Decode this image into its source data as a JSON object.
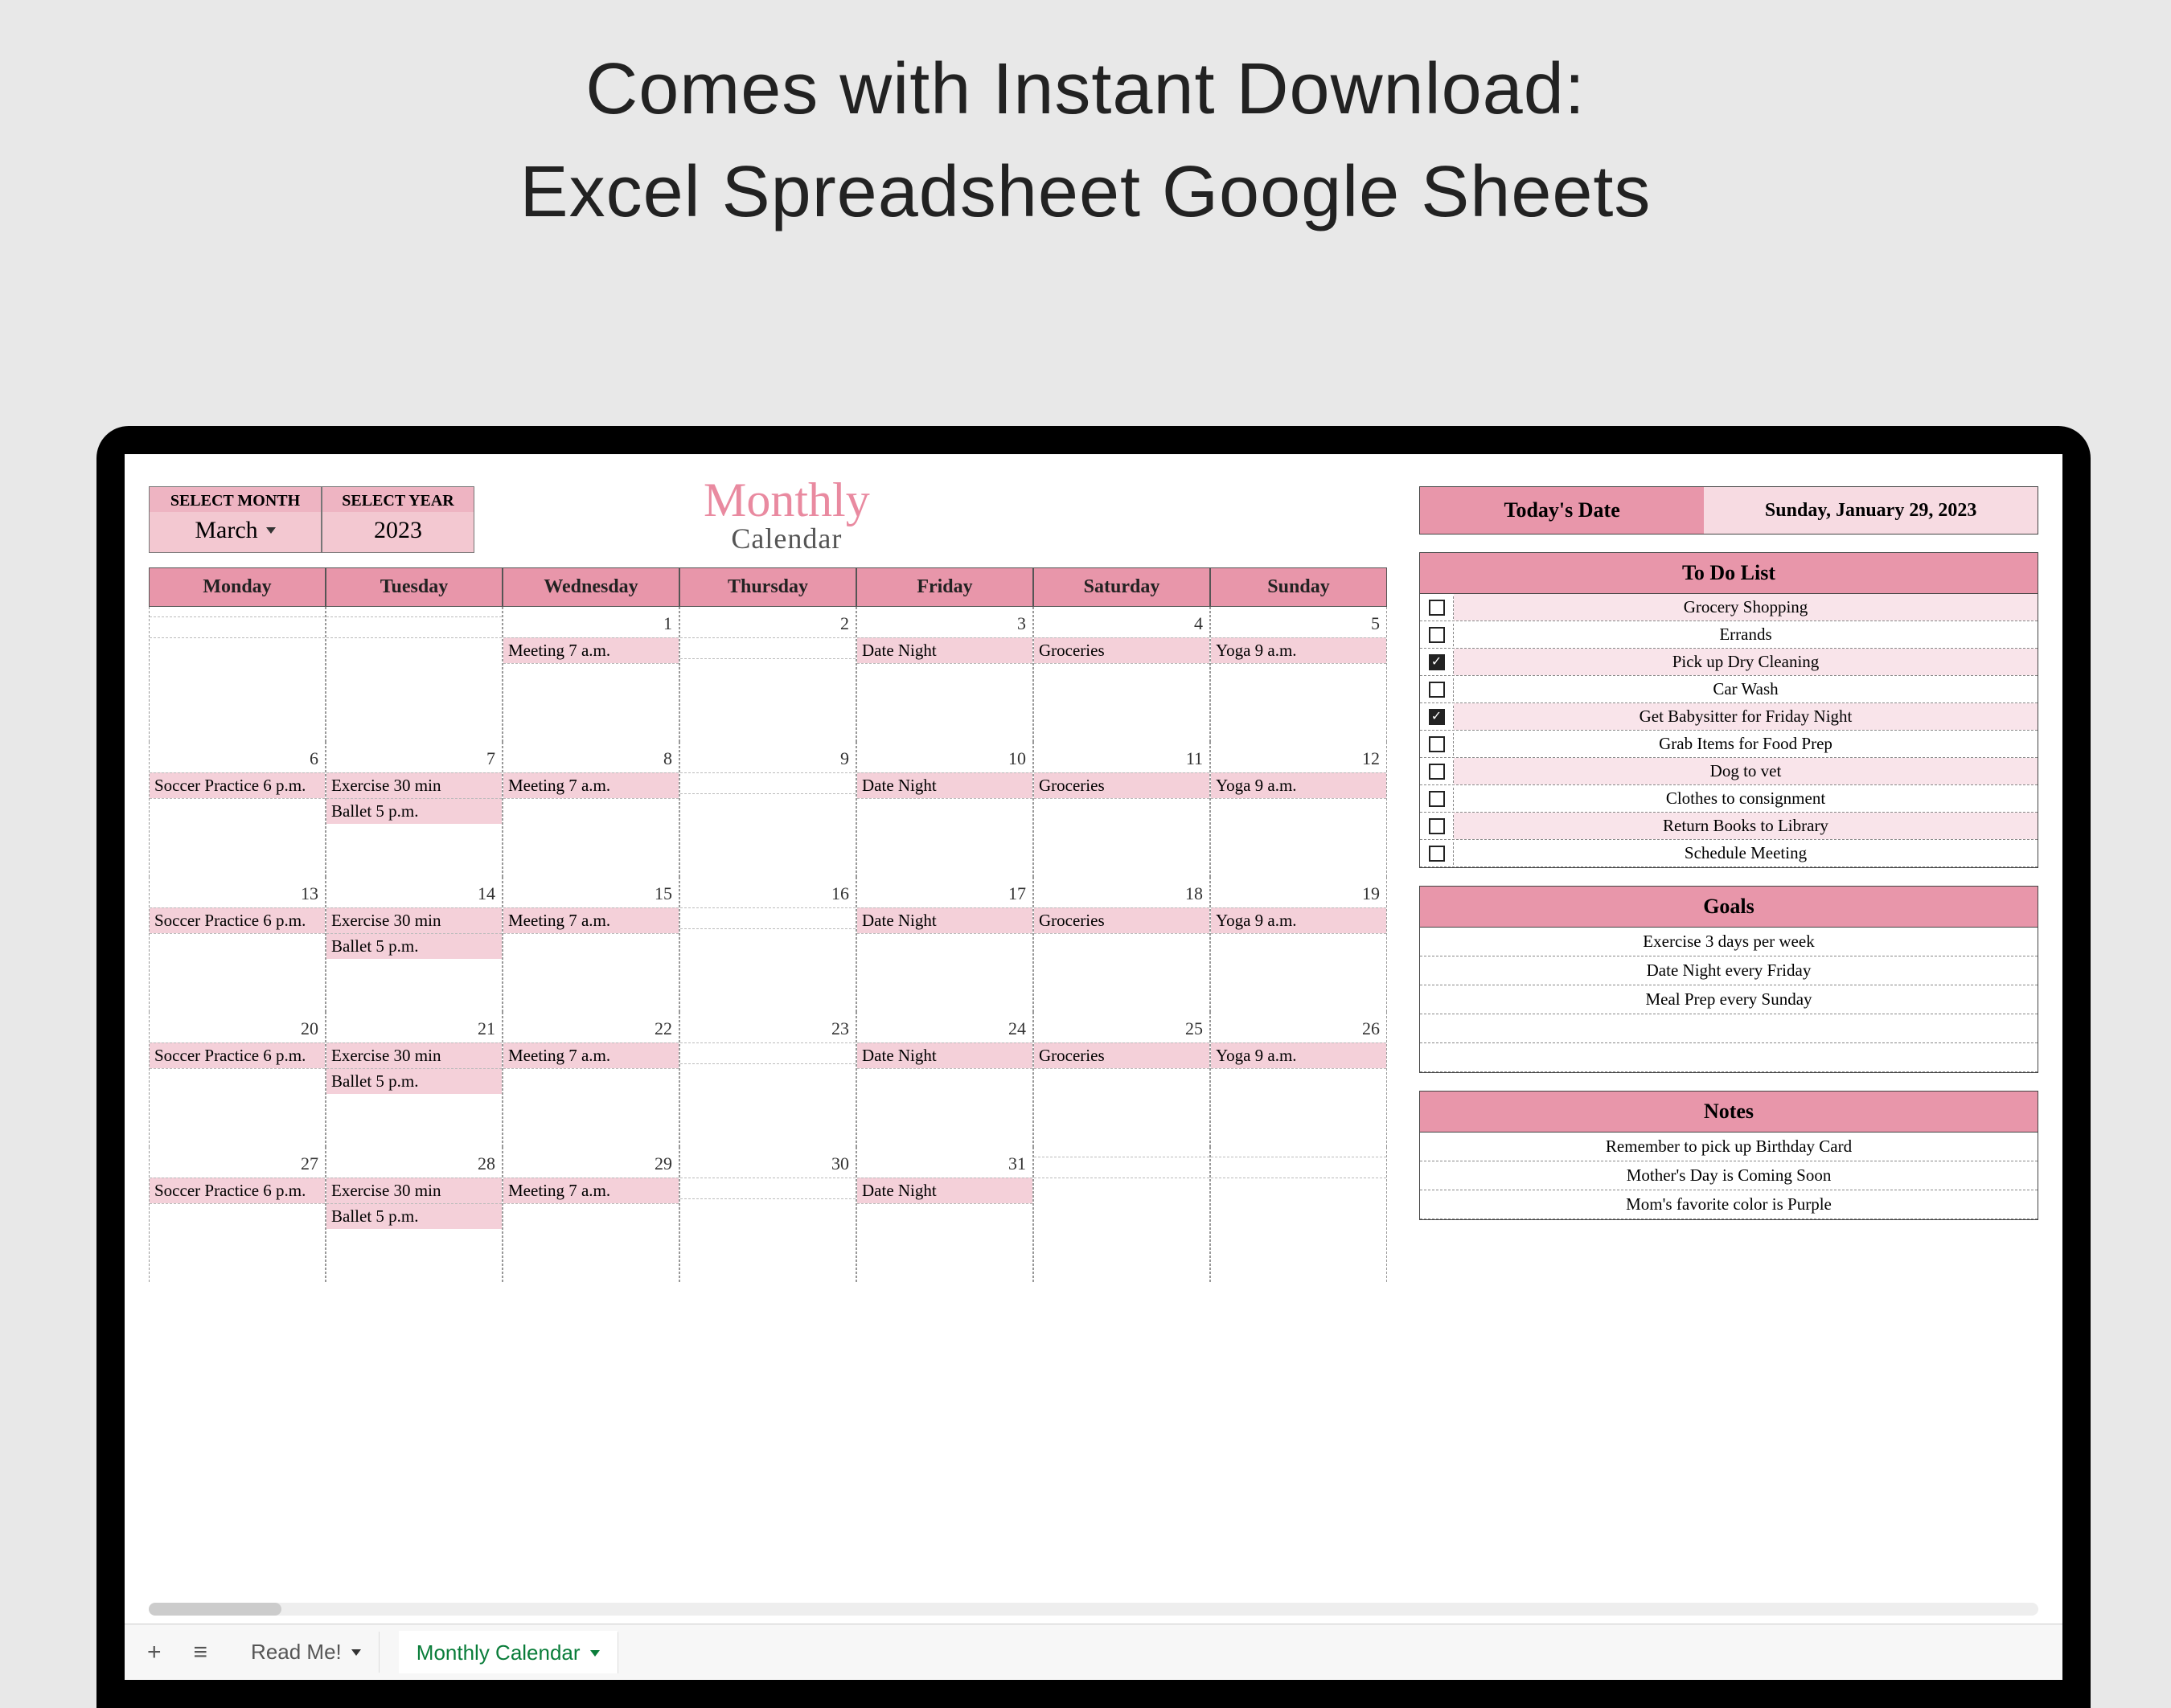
{
  "promo": {
    "line1": "Comes with Instant Download:",
    "line2": "Excel Spreadsheet Google Sheets"
  },
  "selectors": {
    "month_label": "SELECT MONTH",
    "month_value": "March",
    "year_label": "SELECT YEAR",
    "year_value": "2023"
  },
  "logo": {
    "script": "Monthly",
    "sub": "Calendar"
  },
  "day_headers": [
    "Monday",
    "Tuesday",
    "Wednesday",
    "Thursday",
    "Friday",
    "Saturday",
    "Sunday"
  ],
  "weeks": [
    [
      {
        "date": "",
        "events": []
      },
      {
        "date": "",
        "events": []
      },
      {
        "date": "1",
        "events": [
          "Meeting 7 a.m."
        ]
      },
      {
        "date": "2",
        "events": []
      },
      {
        "date": "3",
        "events": [
          "Date Night"
        ]
      },
      {
        "date": "4",
        "events": [
          "Groceries"
        ]
      },
      {
        "date": "5",
        "events": [
          "Yoga 9 a.m."
        ]
      }
    ],
    [
      {
        "date": "6",
        "events": [
          "Soccer Practice 6 p.m."
        ]
      },
      {
        "date": "7",
        "events": [
          "Exercise 30 min",
          "Ballet 5 p.m."
        ]
      },
      {
        "date": "8",
        "events": [
          "Meeting 7 a.m."
        ]
      },
      {
        "date": "9",
        "events": []
      },
      {
        "date": "10",
        "events": [
          "Date Night"
        ]
      },
      {
        "date": "11",
        "events": [
          "Groceries"
        ]
      },
      {
        "date": "12",
        "events": [
          "Yoga 9 a.m."
        ]
      }
    ],
    [
      {
        "date": "13",
        "events": [
          "Soccer Practice 6 p.m."
        ]
      },
      {
        "date": "14",
        "events": [
          "Exercise 30 min",
          "Ballet 5 p.m."
        ]
      },
      {
        "date": "15",
        "events": [
          "Meeting 7 a.m."
        ]
      },
      {
        "date": "16",
        "events": []
      },
      {
        "date": "17",
        "events": [
          "Date Night"
        ]
      },
      {
        "date": "18",
        "events": [
          "Groceries"
        ]
      },
      {
        "date": "19",
        "events": [
          "Yoga 9 a.m."
        ]
      }
    ],
    [
      {
        "date": "20",
        "events": [
          "Soccer Practice 6 p.m."
        ]
      },
      {
        "date": "21",
        "events": [
          "Exercise 30 min",
          "Ballet 5 p.m."
        ]
      },
      {
        "date": "22",
        "events": [
          "Meeting 7 a.m."
        ]
      },
      {
        "date": "23",
        "events": []
      },
      {
        "date": "24",
        "events": [
          "Date Night"
        ]
      },
      {
        "date": "25",
        "events": [
          "Groceries"
        ]
      },
      {
        "date": "26",
        "events": [
          "Yoga 9 a.m."
        ]
      }
    ],
    [
      {
        "date": "27",
        "events": [
          "Soccer Practice 6 p.m."
        ]
      },
      {
        "date": "28",
        "events": [
          "Exercise 30 min",
          "Ballet 5 p.m."
        ]
      },
      {
        "date": "29",
        "events": [
          "Meeting 7 a.m."
        ]
      },
      {
        "date": "30",
        "events": []
      },
      {
        "date": "31",
        "events": [
          "Date Night"
        ]
      },
      {
        "date": "",
        "events": []
      },
      {
        "date": "",
        "events": []
      }
    ]
  ],
  "today": {
    "label": "Today's  Date",
    "value": "Sunday, January 29, 2023"
  },
  "todo": {
    "title": "To Do List",
    "items": [
      {
        "done": false,
        "text": "Grocery Shopping"
      },
      {
        "done": false,
        "text": "Errands"
      },
      {
        "done": true,
        "text": "Pick up Dry Cleaning"
      },
      {
        "done": false,
        "text": "Car Wash"
      },
      {
        "done": true,
        "text": "Get Babysitter for Friday Night"
      },
      {
        "done": false,
        "text": "Grab Items for Food Prep"
      },
      {
        "done": false,
        "text": "Dog to vet"
      },
      {
        "done": false,
        "text": "Clothes to consignment"
      },
      {
        "done": false,
        "text": "Return Books to Library"
      },
      {
        "done": false,
        "text": "Schedule Meeting"
      }
    ]
  },
  "goals": {
    "title": "Goals",
    "items": [
      "Exercise 3 days per week",
      "Date Night every Friday",
      "Meal Prep every Sunday",
      "",
      ""
    ]
  },
  "notes": {
    "title": "Notes",
    "items": [
      "Remember to pick up Birthday Card",
      "Mother's Day is Coming Soon",
      "Mom's favorite color is Purple"
    ]
  },
  "tabs": {
    "tab1": "Read Me!",
    "tab2": "Monthly Calendar"
  }
}
